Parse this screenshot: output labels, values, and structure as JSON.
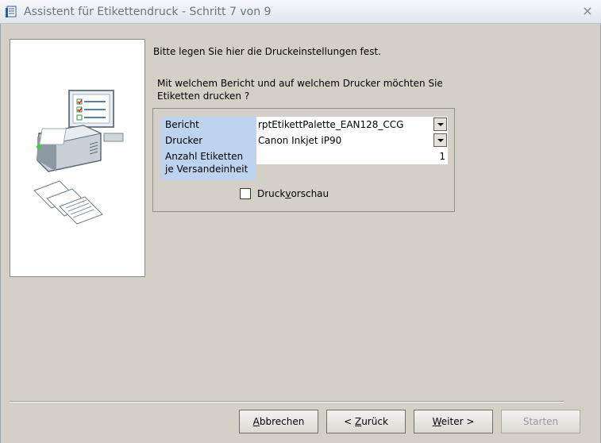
{
  "window": {
    "title": "Assistent für Etikettendruck - Schritt 7 von 9",
    "close_glyph": "×"
  },
  "intro": "Bitte legen Sie hier die Druckeinstellungen fest.",
  "question": "Mit welchem Bericht und auf welchem Drucker möchten Sie Etiketten drucken ?",
  "form": {
    "bericht": {
      "label": "Bericht",
      "value": "rptEtikettPalette_EAN128_CCG"
    },
    "drucker": {
      "label": "Drucker",
      "value": "Canon Inkjet iP90"
    },
    "anzahl": {
      "label_line1": "Anzahl Etiketten",
      "label_line2": "je Versandeinheit",
      "value": "1"
    },
    "druckvorschau": {
      "label_before": "Druck",
      "label_mnemonic": "v",
      "label_after": "orschau",
      "checked": false
    }
  },
  "buttons": {
    "abbrechen": {
      "mnemonic": "A",
      "rest": "bbrechen",
      "enabled": true
    },
    "zurueck": {
      "prefix": "< ",
      "mnemonic": "Z",
      "rest": "urück",
      "enabled": true
    },
    "weiter": {
      "mnemonic": "W",
      "rest": "eiter >",
      "enabled": true
    },
    "starten": {
      "label": "Starten",
      "enabled": false
    }
  },
  "colors": {
    "label_bg": "#bed3f0",
    "dialog_bg": "#d4d0c8"
  }
}
